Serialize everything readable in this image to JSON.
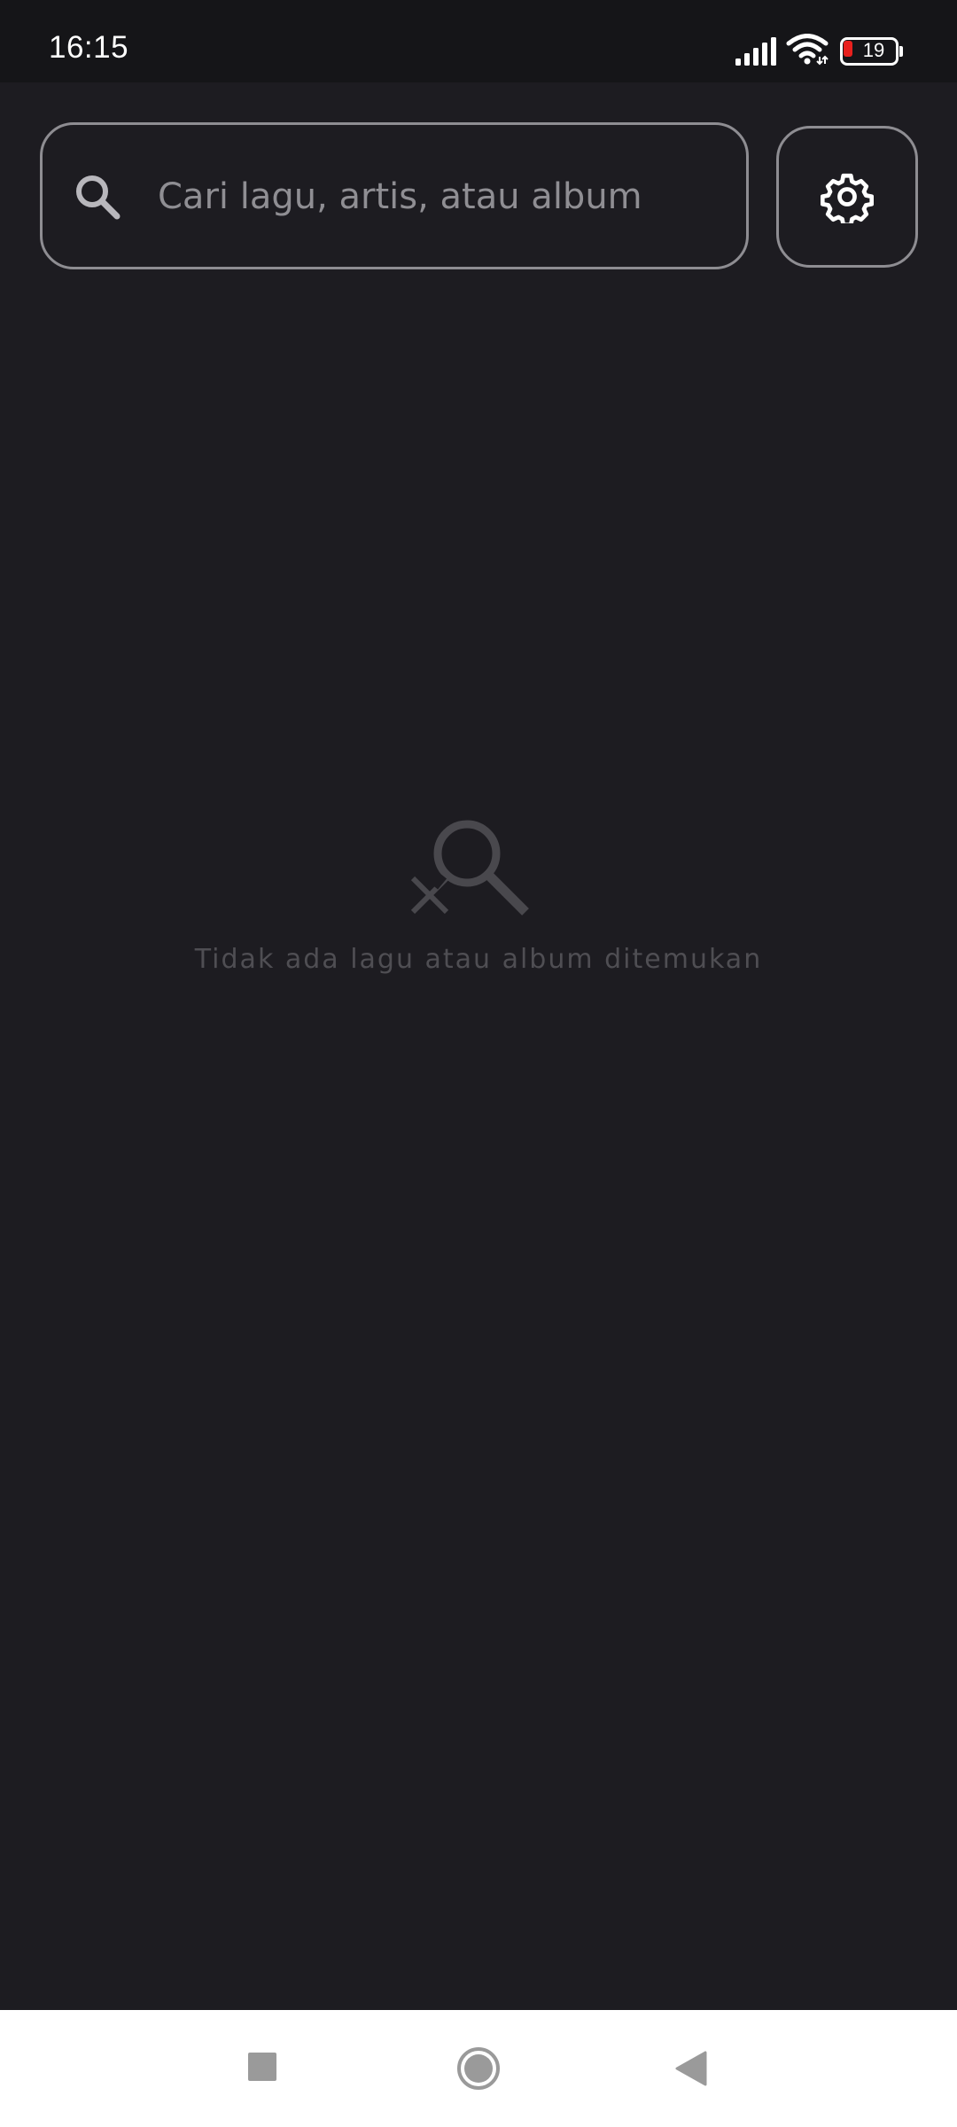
{
  "status_bar": {
    "time": "16:15",
    "battery_level": "19",
    "icons": [
      "signal-icon",
      "wifi-icon",
      "battery-icon"
    ]
  },
  "search": {
    "placeholder": "Cari lagu, artis, atau album",
    "value": "",
    "icon": "search-icon"
  },
  "settings": {
    "icon": "gear-icon"
  },
  "empty_state": {
    "icon": "no-results-search-icon",
    "message": "Tidak ada lagu atau album ditemukan"
  },
  "nav_bar": {
    "icons": [
      "recents-square-icon",
      "home-circle-icon",
      "back-triangle-icon"
    ]
  },
  "colors": {
    "background": "#1d1c21",
    "status_bar": "#151518",
    "border": "#8e8d92",
    "placeholder_text": "#8f8e93",
    "muted_text": "#4f4e53",
    "battery_low": "#e8201d",
    "nav_bar": "#ffffff"
  }
}
